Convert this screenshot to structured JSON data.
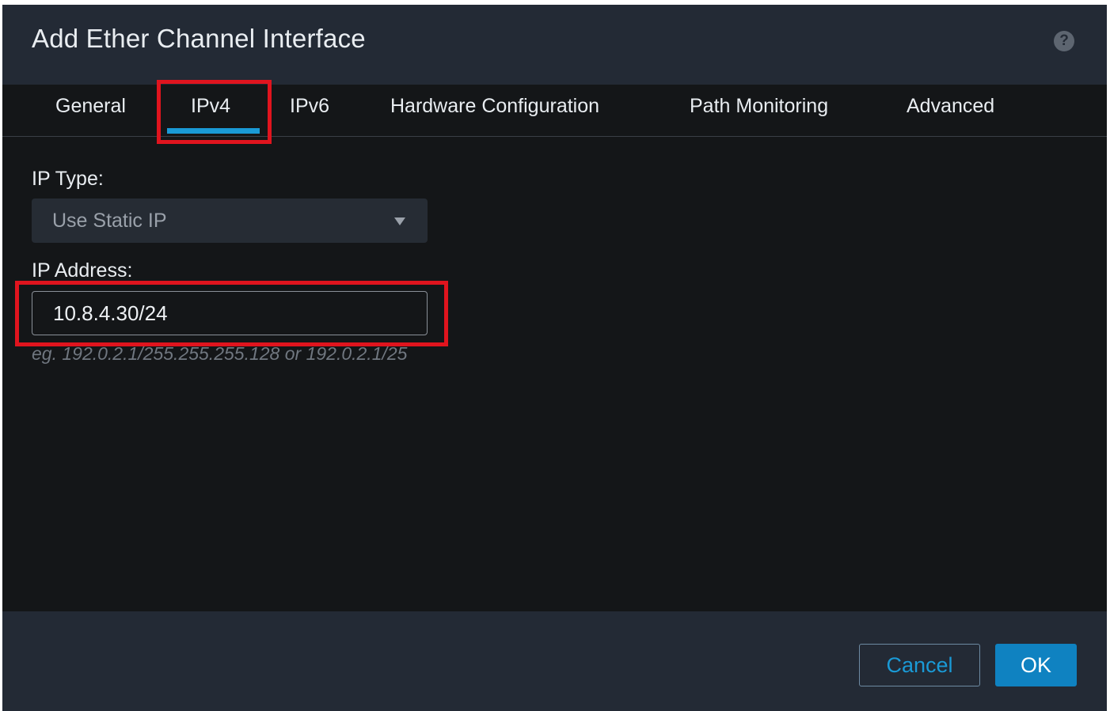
{
  "dialog": {
    "title": "Add Ether Channel Interface",
    "help_icon": "?"
  },
  "tabs": [
    {
      "label": "General",
      "active": false
    },
    {
      "label": "IPv4",
      "active": true
    },
    {
      "label": "IPv6",
      "active": false
    },
    {
      "label": "Hardware Configuration",
      "active": false
    },
    {
      "label": "Path Monitoring",
      "active": false
    },
    {
      "label": "Advanced",
      "active": false
    }
  ],
  "form": {
    "ip_type_label": "IP Type:",
    "ip_type_value": "Use Static IP",
    "ip_address_label": "IP Address:",
    "ip_address_value": "10.8.4.30/24",
    "ip_address_hint": "eg. 192.0.2.1/255.255.255.128 or 192.0.2.1/25"
  },
  "footer": {
    "cancel_label": "Cancel",
    "ok_label": "OK"
  },
  "colors": {
    "header_bg": "#232a35",
    "body_bg": "#141618",
    "accent": "#1a9ad6",
    "primary_button": "#0f82c1",
    "highlight_box": "#e0141e"
  }
}
